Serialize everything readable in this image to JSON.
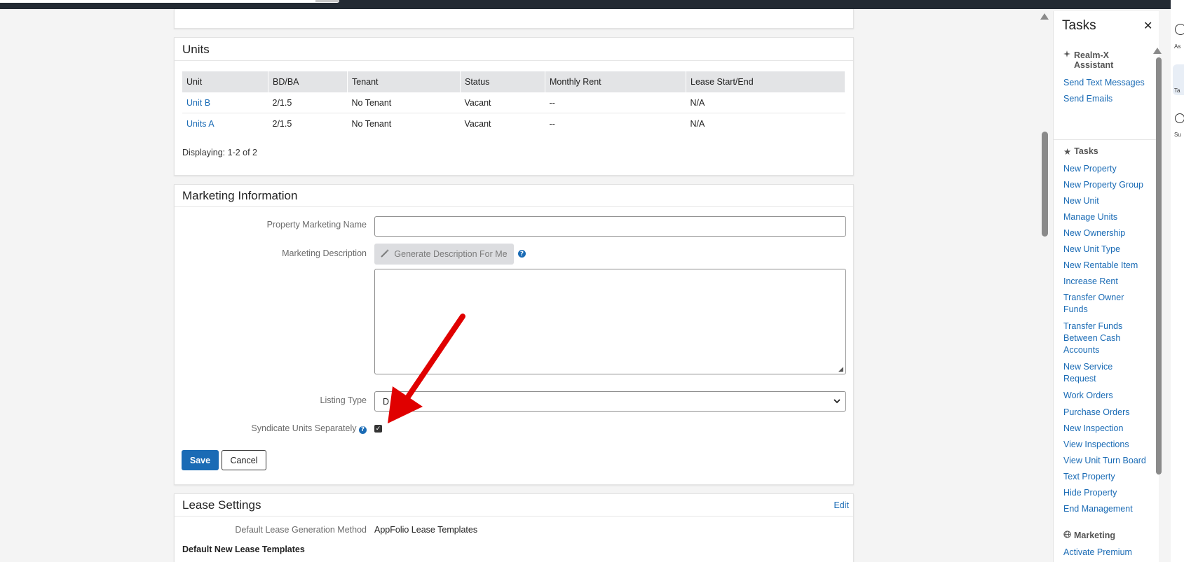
{
  "units": {
    "title": "Units",
    "columns": [
      "Unit",
      "BD/BA",
      "Tenant",
      "Status",
      "Monthly Rent",
      "Lease Start/End"
    ],
    "rows": [
      [
        "Unit B",
        "2/1.5",
        "No Tenant",
        "Vacant",
        "--",
        "N/A"
      ],
      [
        "Units A",
        "2/1.5",
        "No Tenant",
        "Vacant",
        "--",
        "N/A"
      ]
    ],
    "displaying": "Displaying: 1-2 of 2"
  },
  "marketing": {
    "title": "Marketing Information",
    "name_label": "Property Marketing Name",
    "name_value": "",
    "desc_label": "Marketing Description",
    "generate_label": "Generate Description For Me",
    "desc_value": "",
    "listing_label": "Listing Type",
    "listing_value": "D",
    "syndicate_label": "Syndicate Units Separately",
    "syndicate_checked": true,
    "save_label": "Save",
    "cancel_label": "Cancel"
  },
  "lease": {
    "title": "Lease Settings",
    "edit_label": "Edit",
    "method_label": "Default Lease Generation Method",
    "method_value": "AppFolio Lease Templates",
    "templates_heading": "Default New Lease Templates"
  },
  "tasks_panel": {
    "title": "Tasks",
    "assistant_heading": "Realm-X Assistant",
    "assistant_items": [
      "Send Text Messages",
      "Send Emails"
    ],
    "tasks_heading": "Tasks",
    "task_items": [
      "New Property",
      "New Property Group",
      "New Unit",
      "Manage Units",
      "New Ownership",
      "New Unit Type",
      "New Rentable Item",
      "Increase Rent",
      "Transfer Owner Funds",
      "Transfer Funds Between Cash Accounts",
      "New Service Request",
      "Work Orders",
      "Purchase Orders",
      "New Inspection",
      "View Inspections",
      "View Unit Turn Board",
      "Text Property",
      "Hide Property",
      "End Management"
    ],
    "marketing_heading": "Marketing",
    "marketing_items": [
      "Activate Premium"
    ]
  },
  "right_strip": {
    "labels": [
      "As",
      "Ta",
      "Su"
    ]
  },
  "colors": {
    "link": "#1a6bb5",
    "annotation_arrow": "#e00000"
  }
}
